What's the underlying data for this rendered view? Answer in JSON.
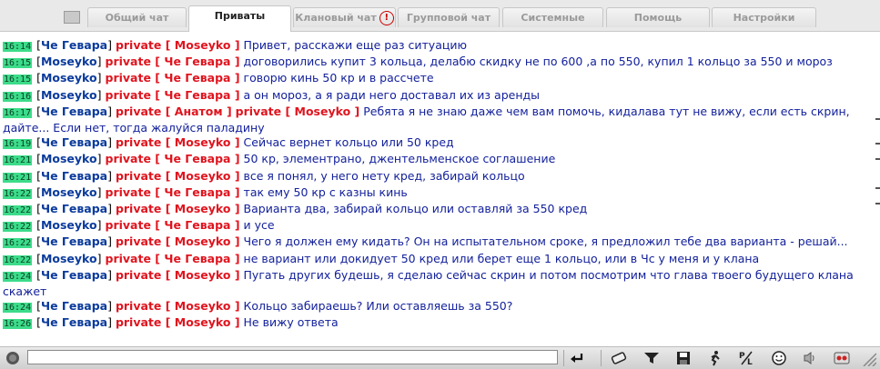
{
  "tabs": [
    {
      "label": "Общий чат",
      "active": false
    },
    {
      "label": "Приваты",
      "active": true
    },
    {
      "label": "Клановый чат",
      "active": false,
      "alert": "!"
    },
    {
      "label": "Групповой чат",
      "active": false
    },
    {
      "label": "Системные",
      "active": false
    },
    {
      "label": "Помощь",
      "active": false
    },
    {
      "label": "Настройки",
      "active": false
    }
  ],
  "messages": [
    {
      "time": "16:14",
      "nick": "Че Гевара",
      "to": "Moseyko",
      "text": "Привет, расскажи еще раз ситуацию"
    },
    {
      "time": "16:15",
      "nick": "Moseyko",
      "to": "Че Гевара",
      "text": "договорились купит 3 кольца, делабю скидку не по 600 ,а по 550, купил 1 кольцо за 550 и мороз"
    },
    {
      "time": "16:15",
      "nick": "Moseyko",
      "to": "Че Гевара",
      "text": "говорю кинь 50 кр и в рассчете"
    },
    {
      "time": "16:16",
      "nick": "Moseyko",
      "to": "Че Гевара",
      "text": "а он мороз, а я ради него доставал их из аренды"
    },
    {
      "time": "16:17",
      "nick": "Че Гевара",
      "to": "Анатом",
      "to2": "Moseyko",
      "text": "Ребята я не знаю даже чем вам помочь, кидалава тут не вижу, если есть скрин, дайте... Если нет, тогда жалуйся паладину"
    },
    {
      "time": "16:19",
      "nick": "Че Гевара",
      "to": "Moseyko",
      "text": "Сейчас вернет кольцо или 50 кред"
    },
    {
      "time": "16:21",
      "nick": "Moseyko",
      "to": "Че Гевара",
      "text": "50 кр, элементрано, джентельменское соглашение"
    },
    {
      "time": "16:21",
      "nick": "Че Гевара",
      "to": "Moseyko",
      "text": "все я понял, у него нету кред, забирай кольцо"
    },
    {
      "time": "16:22",
      "nick": "Moseyko",
      "to": "Че Гевара",
      "text": "так ему 50 кр с казны кинь"
    },
    {
      "time": "16:22",
      "nick": "Че Гевара",
      "to": "Moseyko",
      "text": "Варианта два, забирай кольцо или оставляй за 550 кред"
    },
    {
      "time": "16:22",
      "nick": "Moseyko",
      "to": "Че Гевара",
      "text": "и усе"
    },
    {
      "time": "16:22",
      "nick": "Че Гевара",
      "to": "Moseyko",
      "text": "Чего я должен ему кидать? Он на испытательном сроке, я предложил тебе два варианта - решай..."
    },
    {
      "time": "16:22",
      "nick": "Moseyko",
      "to": "Че Гевара",
      "text": "не вариант или докидует 50 кред или берет еще 1 кольцо, или в Чс у меня и у клана"
    },
    {
      "time": "16:24",
      "nick": "Че Гевара",
      "to": "Moseyko",
      "text": "Пугать других будешь, я сделаю сейчас скрин и потом посмотрим что глава твоего будущего клана скажет"
    },
    {
      "time": "16:24",
      "nick": "Че Гевара",
      "to": "Moseyko",
      "text": "Кольцо забираешь? Или оставляешь за 550?"
    },
    {
      "time": "16:26",
      "nick": "Че Гевара",
      "to": "Moseyko",
      "text": "Не вижу ответа"
    }
  ],
  "private_label": "private",
  "input": {
    "value": "",
    "placeholder": ""
  },
  "toolbar_icons": [
    "smiley-head-icon",
    "send-enter-icon",
    "eraser-icon",
    "filter-icon",
    "save-disk-icon",
    "running-man-icon",
    "translit-icon",
    "smile-icon",
    "sound-icon",
    "record-icon",
    "scroll-grip-icon"
  ],
  "colors": {
    "time_bg": "#3cdc8a",
    "nick": "#0a3a9c",
    "private": "#e0141e",
    "text": "#13219b"
  }
}
